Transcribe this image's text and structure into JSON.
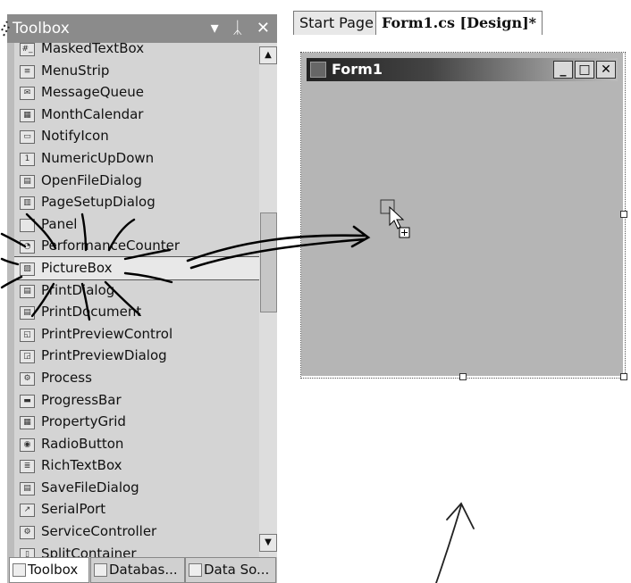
{
  "toolbox": {
    "title": "Toolbox",
    "title_buttons": [
      "▾",
      "ᛣ",
      "✕"
    ],
    "items": [
      {
        "label": "MaskedTextBox",
        "icon": "masked-textbox-icon",
        "glyph": "#_"
      },
      {
        "label": "MenuStrip",
        "icon": "menustrip-icon",
        "glyph": "≡"
      },
      {
        "label": "MessageQueue",
        "icon": "messagequeue-icon",
        "glyph": "✉"
      },
      {
        "label": "MonthCalendar",
        "icon": "monthcalendar-icon",
        "glyph": "▦"
      },
      {
        "label": "NotifyIcon",
        "icon": "notifyicon-icon",
        "glyph": "▭"
      },
      {
        "label": "NumericUpDown",
        "icon": "numericupdown-icon",
        "glyph": "1"
      },
      {
        "label": "OpenFileDialog",
        "icon": "openfiledialog-icon",
        "glyph": "▤"
      },
      {
        "label": "PageSetupDialog",
        "icon": "pagesetupdialog-icon",
        "glyph": "▥"
      },
      {
        "label": "Panel",
        "icon": "panel-icon",
        "glyph": ""
      },
      {
        "label": "PerformanceCounter",
        "icon": "performancecounter-icon",
        "glyph": "◔"
      },
      {
        "label": "PictureBox",
        "icon": "picturebox-icon",
        "glyph": "▨"
      },
      {
        "label": "PrintDialog",
        "icon": "printdialog-icon",
        "glyph": "▤"
      },
      {
        "label": "PrintDocument",
        "icon": "printdocument-icon",
        "glyph": "▤"
      },
      {
        "label": "PrintPreviewControl",
        "icon": "printpreviewcontrol-icon",
        "glyph": "◱"
      },
      {
        "label": "PrintPreviewDialog",
        "icon": "printpreviewdialog-icon",
        "glyph": "◲"
      },
      {
        "label": "Process",
        "icon": "process-icon",
        "glyph": "⚙"
      },
      {
        "label": "ProgressBar",
        "icon": "progressbar-icon",
        "glyph": "▬"
      },
      {
        "label": "PropertyGrid",
        "icon": "propertygrid-icon",
        "glyph": "▦"
      },
      {
        "label": "RadioButton",
        "icon": "radiobutton-icon",
        "glyph": "◉"
      },
      {
        "label": "RichTextBox",
        "icon": "richtextbox-icon",
        "glyph": "≣"
      },
      {
        "label": "SaveFileDialog",
        "icon": "savefiledialog-icon",
        "glyph": "▤"
      },
      {
        "label": "SerialPort",
        "icon": "serialport-icon",
        "glyph": "↗"
      },
      {
        "label": "ServiceController",
        "icon": "servicecontroller-icon",
        "glyph": "⚙"
      },
      {
        "label": "SplitContainer",
        "icon": "splitcontainer-icon",
        "glyph": "▯"
      }
    ],
    "scroll_up": "▲",
    "scroll_down": "▼",
    "tabs": [
      "Toolbox",
      "Databas...",
      "Data So..."
    ]
  },
  "designer": {
    "tabs": [
      "Start Page",
      "Form1.cs [Design]*"
    ],
    "form": {
      "title": "Form1",
      "buttons": [
        "_",
        "□",
        "✕"
      ]
    }
  }
}
